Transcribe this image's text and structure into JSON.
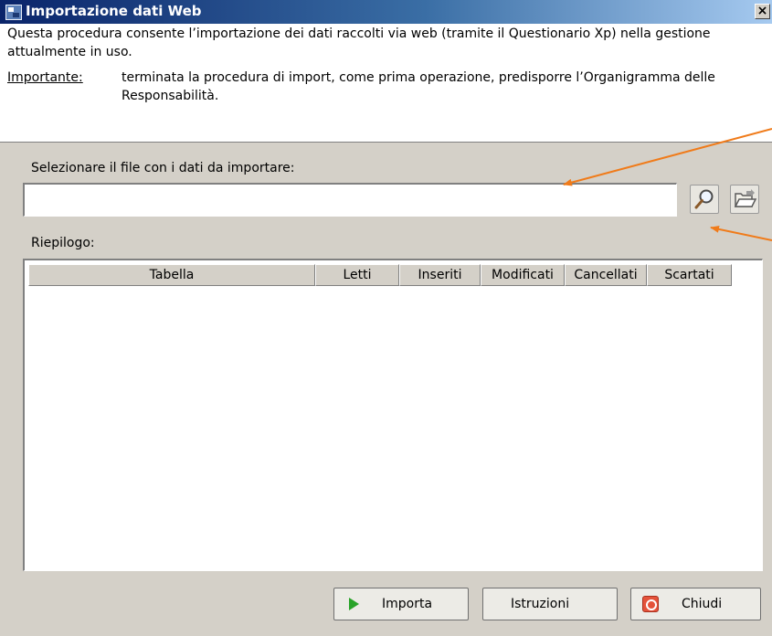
{
  "window": {
    "title": "Importazione dati Web",
    "close_label": "×"
  },
  "info": {
    "intro": "Questa procedura consente l’importazione dei dati raccolti via web (tramite il Questionario Xp) nella gestione attualmente in uso.",
    "note_label": "Importante:",
    "note_text": "terminata la procedura di import, come prima operazione, predisporre l’Organigramma delle Responsabilità."
  },
  "file_select": {
    "label": "Selezionare il file con i dati da importare:",
    "value": "",
    "placeholder": "",
    "search_icon": "search-icon",
    "folder_icon": "folder-open-icon"
  },
  "summary": {
    "label": "Riepilogo:",
    "columns": [
      "Tabella",
      "Letti",
      "Inseriti",
      "Modificati",
      "Cancellati",
      "Scartati"
    ],
    "rows": []
  },
  "buttons": {
    "importa": "Importa",
    "istruzioni": "Istruzioni",
    "chiudi": "Chiudi"
  },
  "colors": {
    "title_bar_start": "#0a246a",
    "title_bar_end": "#a6caf0",
    "annotation_arrow": "#f07b1a",
    "dialog_bg": "#d4d0c8"
  }
}
